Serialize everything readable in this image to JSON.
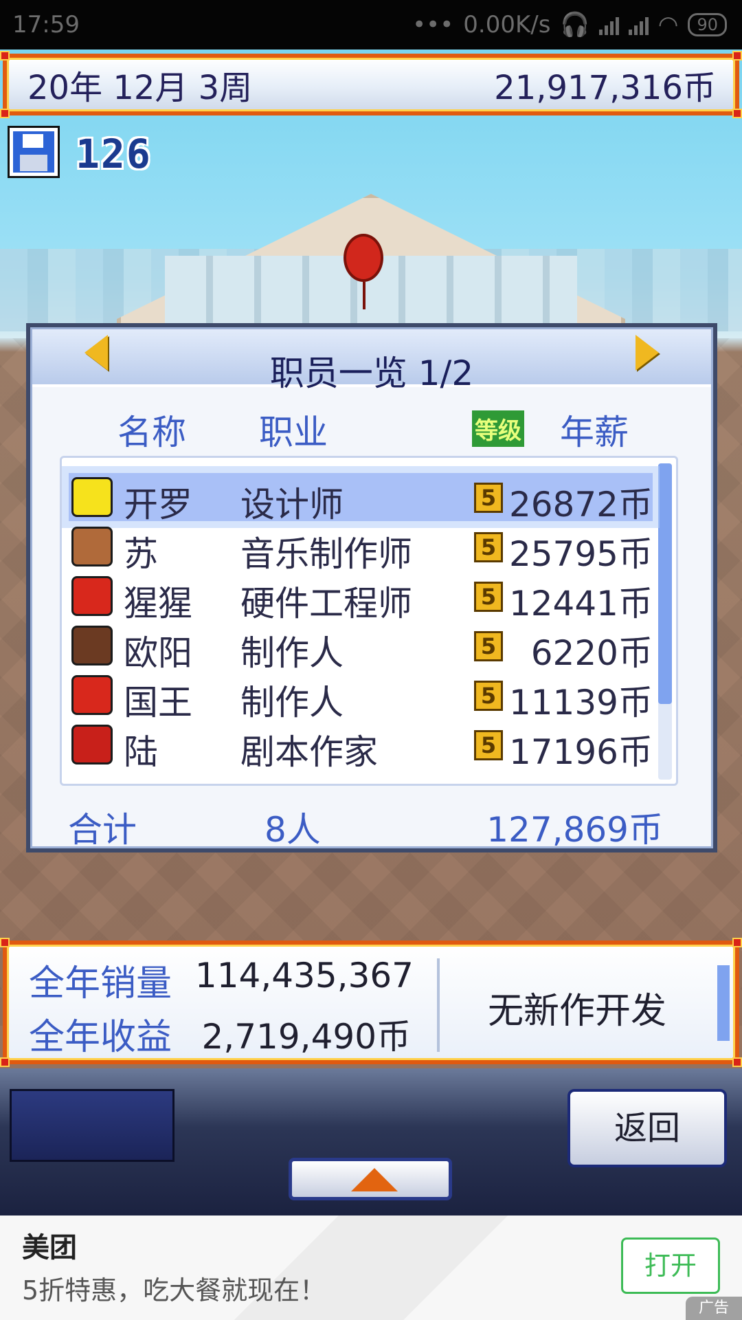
{
  "status_bar": {
    "time": "17:59",
    "dots": "•••",
    "speed": "0.00K/s",
    "battery": "90"
  },
  "top_bar": {
    "date": "20年 12月 3周",
    "money": "21,917,316币"
  },
  "save": {
    "count": "126"
  },
  "staff_panel": {
    "title": "职员一览 1/2",
    "headers": {
      "name": "名称",
      "job": "职业",
      "level": "等级",
      "salary": "年薪"
    },
    "rows": [
      {
        "name": "开罗",
        "job": "设计师",
        "level": "5",
        "salary": "26872币",
        "avatar_color": "#f6e21c"
      },
      {
        "name": "苏",
        "job": "音乐制作师",
        "level": "5",
        "salary": "25795币",
        "avatar_color": "#b06a3a"
      },
      {
        "name": "猩猩",
        "job": "硬件工程师",
        "level": "5",
        "salary": "12441币",
        "avatar_color": "#d8281c"
      },
      {
        "name": "欧阳",
        "job": "制作人",
        "level": "5",
        "salary": "6220币",
        "avatar_color": "#6b3a22"
      },
      {
        "name": "国王",
        "job": "制作人",
        "level": "5",
        "salary": "11139币",
        "avatar_color": "#d8281c"
      },
      {
        "name": "陆",
        "job": "剧本作家",
        "level": "5",
        "salary": "17196币",
        "avatar_color": "#c8201a"
      }
    ],
    "total": {
      "label": "合计",
      "count": "8人",
      "sum": "127,869币"
    }
  },
  "info_bar": {
    "sales_label": "全年销量",
    "sales_value": "114,435,367",
    "income_label": "全年收益",
    "income_value": "2,719,490币",
    "status": "无新作开发"
  },
  "controls": {
    "back_label": "返回"
  },
  "ad": {
    "title": "美团",
    "description": "5折特惠，吃大餐就现在！",
    "button": "打开",
    "tag": "广告"
  },
  "colors": {
    "accent_orange": "#e05a10",
    "header_blue": "#3b5cc4",
    "selection": "#a9c0f7"
  }
}
